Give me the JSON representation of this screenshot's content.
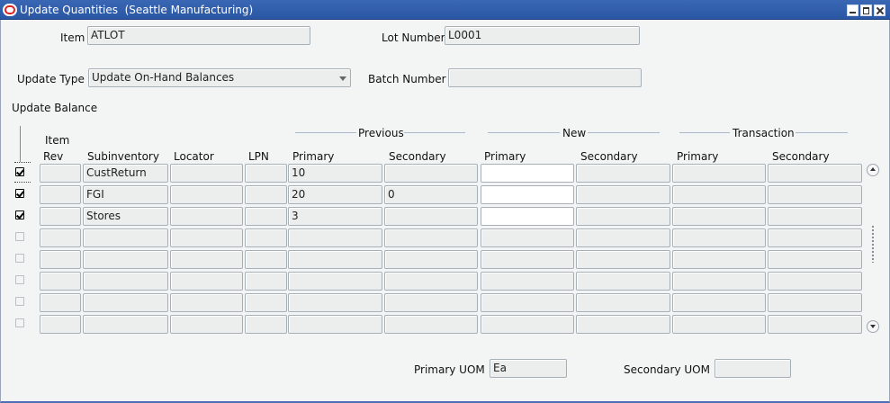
{
  "window": {
    "title": "Update Quantities  (Seattle Manufacturing)",
    "icon": "oracle-icon"
  },
  "header": {
    "item_label": "Item",
    "item_value": "ATLOT",
    "lot_label": "Lot Number",
    "lot_value": "L0001",
    "update_type_label": "Update Type",
    "update_type_value": "Update On-Hand Balances",
    "batch_label": "Batch Number",
    "batch_value": ""
  },
  "balance": {
    "section_label": "Update Balance",
    "groups": {
      "previous": "Previous",
      "new": "New",
      "transaction": "Transaction"
    },
    "columns": {
      "item_rev_top": "Item",
      "item_rev_bottom": "Rev",
      "subinventory": "Subinventory",
      "locator": "Locator",
      "lpn": "LPN",
      "prev_primary": "Primary",
      "prev_secondary": "Secondary",
      "new_primary": "Primary",
      "new_secondary": "Secondary",
      "txn_primary": "Primary",
      "txn_secondary": "Secondary"
    },
    "rows": [
      {
        "checked": true,
        "rev": "",
        "subinventory": "CustReturn",
        "locator": "",
        "lpn": "",
        "prev_primary": "10",
        "prev_secondary": "",
        "new_primary": "",
        "new_secondary": "",
        "txn_primary": "",
        "txn_secondary": ""
      },
      {
        "checked": true,
        "rev": "",
        "subinventory": "FGI",
        "locator": "",
        "lpn": "",
        "prev_primary": "20",
        "prev_secondary": "0",
        "new_primary": "",
        "new_secondary": "",
        "txn_primary": "",
        "txn_secondary": ""
      },
      {
        "checked": true,
        "rev": "",
        "subinventory": "Stores",
        "locator": "",
        "lpn": "",
        "prev_primary": "3",
        "prev_secondary": "",
        "new_primary": "",
        "new_secondary": "",
        "txn_primary": "",
        "txn_secondary": ""
      },
      {
        "checked": false,
        "rev": "",
        "subinventory": "",
        "locator": "",
        "lpn": "",
        "prev_primary": "",
        "prev_secondary": "",
        "new_primary": "",
        "new_secondary": "",
        "txn_primary": "",
        "txn_secondary": ""
      },
      {
        "checked": false,
        "rev": "",
        "subinventory": "",
        "locator": "",
        "lpn": "",
        "prev_primary": "",
        "prev_secondary": "",
        "new_primary": "",
        "new_secondary": "",
        "txn_primary": "",
        "txn_secondary": ""
      },
      {
        "checked": false,
        "rev": "",
        "subinventory": "",
        "locator": "",
        "lpn": "",
        "prev_primary": "",
        "prev_secondary": "",
        "new_primary": "",
        "new_secondary": "",
        "txn_primary": "",
        "txn_secondary": ""
      },
      {
        "checked": false,
        "rev": "",
        "subinventory": "",
        "locator": "",
        "lpn": "",
        "prev_primary": "",
        "prev_secondary": "",
        "new_primary": "",
        "new_secondary": "",
        "txn_primary": "",
        "txn_secondary": ""
      },
      {
        "checked": false,
        "rev": "",
        "subinventory": "",
        "locator": "",
        "lpn": "",
        "prev_primary": "",
        "prev_secondary": "",
        "new_primary": "",
        "new_secondary": "",
        "txn_primary": "",
        "txn_secondary": ""
      }
    ]
  },
  "footer": {
    "primary_uom_label": "Primary UOM",
    "primary_uom_value": "Ea",
    "secondary_uom_label": "Secondary UOM",
    "secondary_uom_value": ""
  }
}
